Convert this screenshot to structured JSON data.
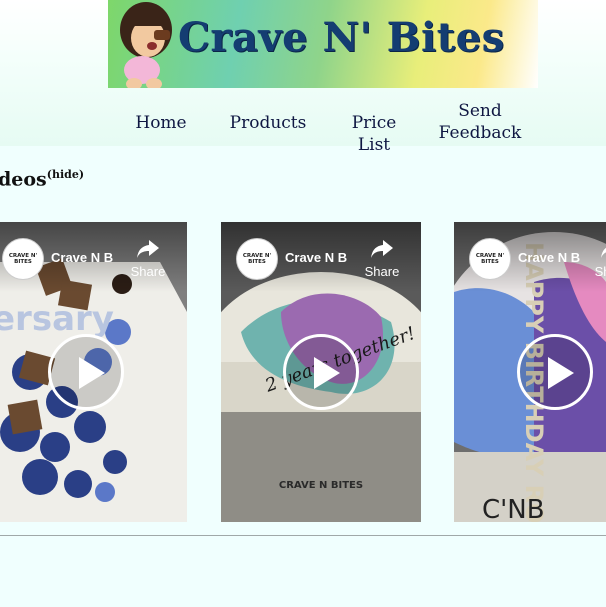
{
  "brand": {
    "title": "Crave N' Bites"
  },
  "nav": {
    "items": [
      {
        "label": "Home"
      },
      {
        "label": "Products"
      },
      {
        "label": "Price List"
      },
      {
        "label_line1": "Send",
        "label_line2": "Feedback"
      }
    ]
  },
  "videos_section": {
    "title": "deos",
    "hide_label": "(hide)"
  },
  "videos": [
    {
      "channel": "Crave N Bites",
      "share": "Share",
      "avatar_text": "CRAVE N' BITES",
      "cake_text": "ersary"
    },
    {
      "channel": "Crave N Bites",
      "share": "Share",
      "avatar_text": "CRAVE N' BITES",
      "cake_text": "2 years together!",
      "watermark": "CRAVE N BITES"
    },
    {
      "channel": "Crave N Bites",
      "share": "Share",
      "avatar_text": "CRAVE N' BITES",
      "cake_text": "HAPPY BIRTHDAY ROSE",
      "watermark": "C'NB"
    }
  ],
  "colors": {
    "nav_text": "#0f1742",
    "title_text": "#143d72",
    "background": "#f0fffe"
  }
}
